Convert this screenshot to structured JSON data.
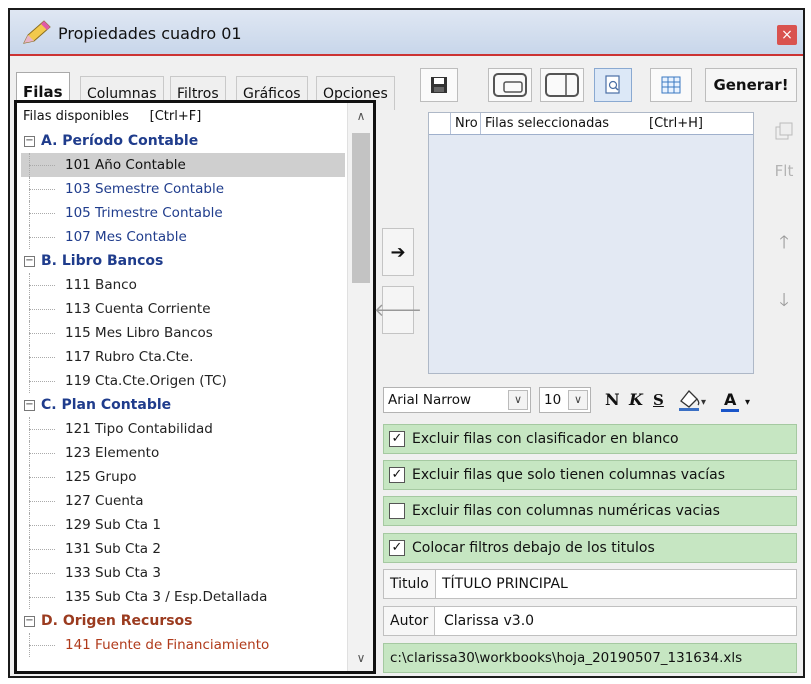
{
  "window": {
    "title": "Propiedades cuadro 01",
    "close_glyph": "×"
  },
  "tabs": [
    {
      "label": "Filas",
      "active": true
    },
    {
      "label": "Columnas"
    },
    {
      "label": "Filtros"
    },
    {
      "label": "Gráficos"
    },
    {
      "label": "Opciones"
    }
  ],
  "toolbar": {
    "icons": [
      "save-icon",
      "layout-top-icon",
      "layout-side-icon",
      "page-preview-icon",
      "grid-icon"
    ],
    "generate_label": "Generar!"
  },
  "rows_panel": {
    "header": "Filas disponibles",
    "shortcut": "[Ctrl+F]",
    "groups": [
      {
        "label": "A. Período Contable",
        "items": [
          {
            "label": "101 Año Contable",
            "selected": true
          },
          {
            "label": "103 Semestre Contable"
          },
          {
            "label": "105 Trimestre Contable"
          },
          {
            "label": "107 Mes Contable"
          }
        ]
      },
      {
        "label": "B. Libro Bancos",
        "items": [
          {
            "label": "111 Banco"
          },
          {
            "label": "113 Cuenta Corriente"
          },
          {
            "label": "115 Mes Libro Bancos"
          },
          {
            "label": "117 Rubro Cta.Cte."
          },
          {
            "label": "119 Cta.Cte.Origen (TC)"
          }
        ]
      },
      {
        "label": "C. Plan Contable",
        "items": [
          {
            "label": "121 Tipo Contabilidad"
          },
          {
            "label": "123 Elemento"
          },
          {
            "label": "125 Grupo"
          },
          {
            "label": "127 Cuenta"
          },
          {
            "label": "129 Sub Cta 1"
          },
          {
            "label": "131 Sub Cta 2"
          },
          {
            "label": "133 Sub Cta 3"
          },
          {
            "label": "135 Sub Cta 3 / Esp.Detallada"
          }
        ]
      },
      {
        "label": "D. Origen Recursos",
        "items": [
          {
            "label": "141 Fuente de Financiamiento"
          }
        ]
      }
    ]
  },
  "selected_panel": {
    "col_nro": "Nro",
    "col_label": "Filas seleccionadas",
    "shortcut": "[Ctrl+H]",
    "side_button": "Flt"
  },
  "format": {
    "font": "Arial Narrow",
    "size": "10",
    "bold": "N",
    "italic": "K",
    "strike": "S",
    "font_color_glyph": "A"
  },
  "options": [
    {
      "label": "Excluir filas con clasificador en blanco",
      "checked": true
    },
    {
      "label": "Excluir filas que solo tienen columnas vacías",
      "checked": true
    },
    {
      "label": "Excluir filas con columnas numéricas vacias",
      "checked": false
    },
    {
      "label": "Colocar filtros debajo de los titulos",
      "checked": true
    }
  ],
  "title_field": {
    "label": "Titulo",
    "value": "TÍTULO PRINCIPAL"
  },
  "author_field": {
    "label": "Autor",
    "value": "Clarissa v3.0"
  },
  "path": "c:\\clarissa30\\workbooks\\hoja_20190507_131634.xls",
  "colors": {
    "group_blue": "#1f3c8c",
    "group_brown": "#9b3b1f",
    "option_green": "#c6e6c2",
    "close_red": "#d9534f"
  }
}
